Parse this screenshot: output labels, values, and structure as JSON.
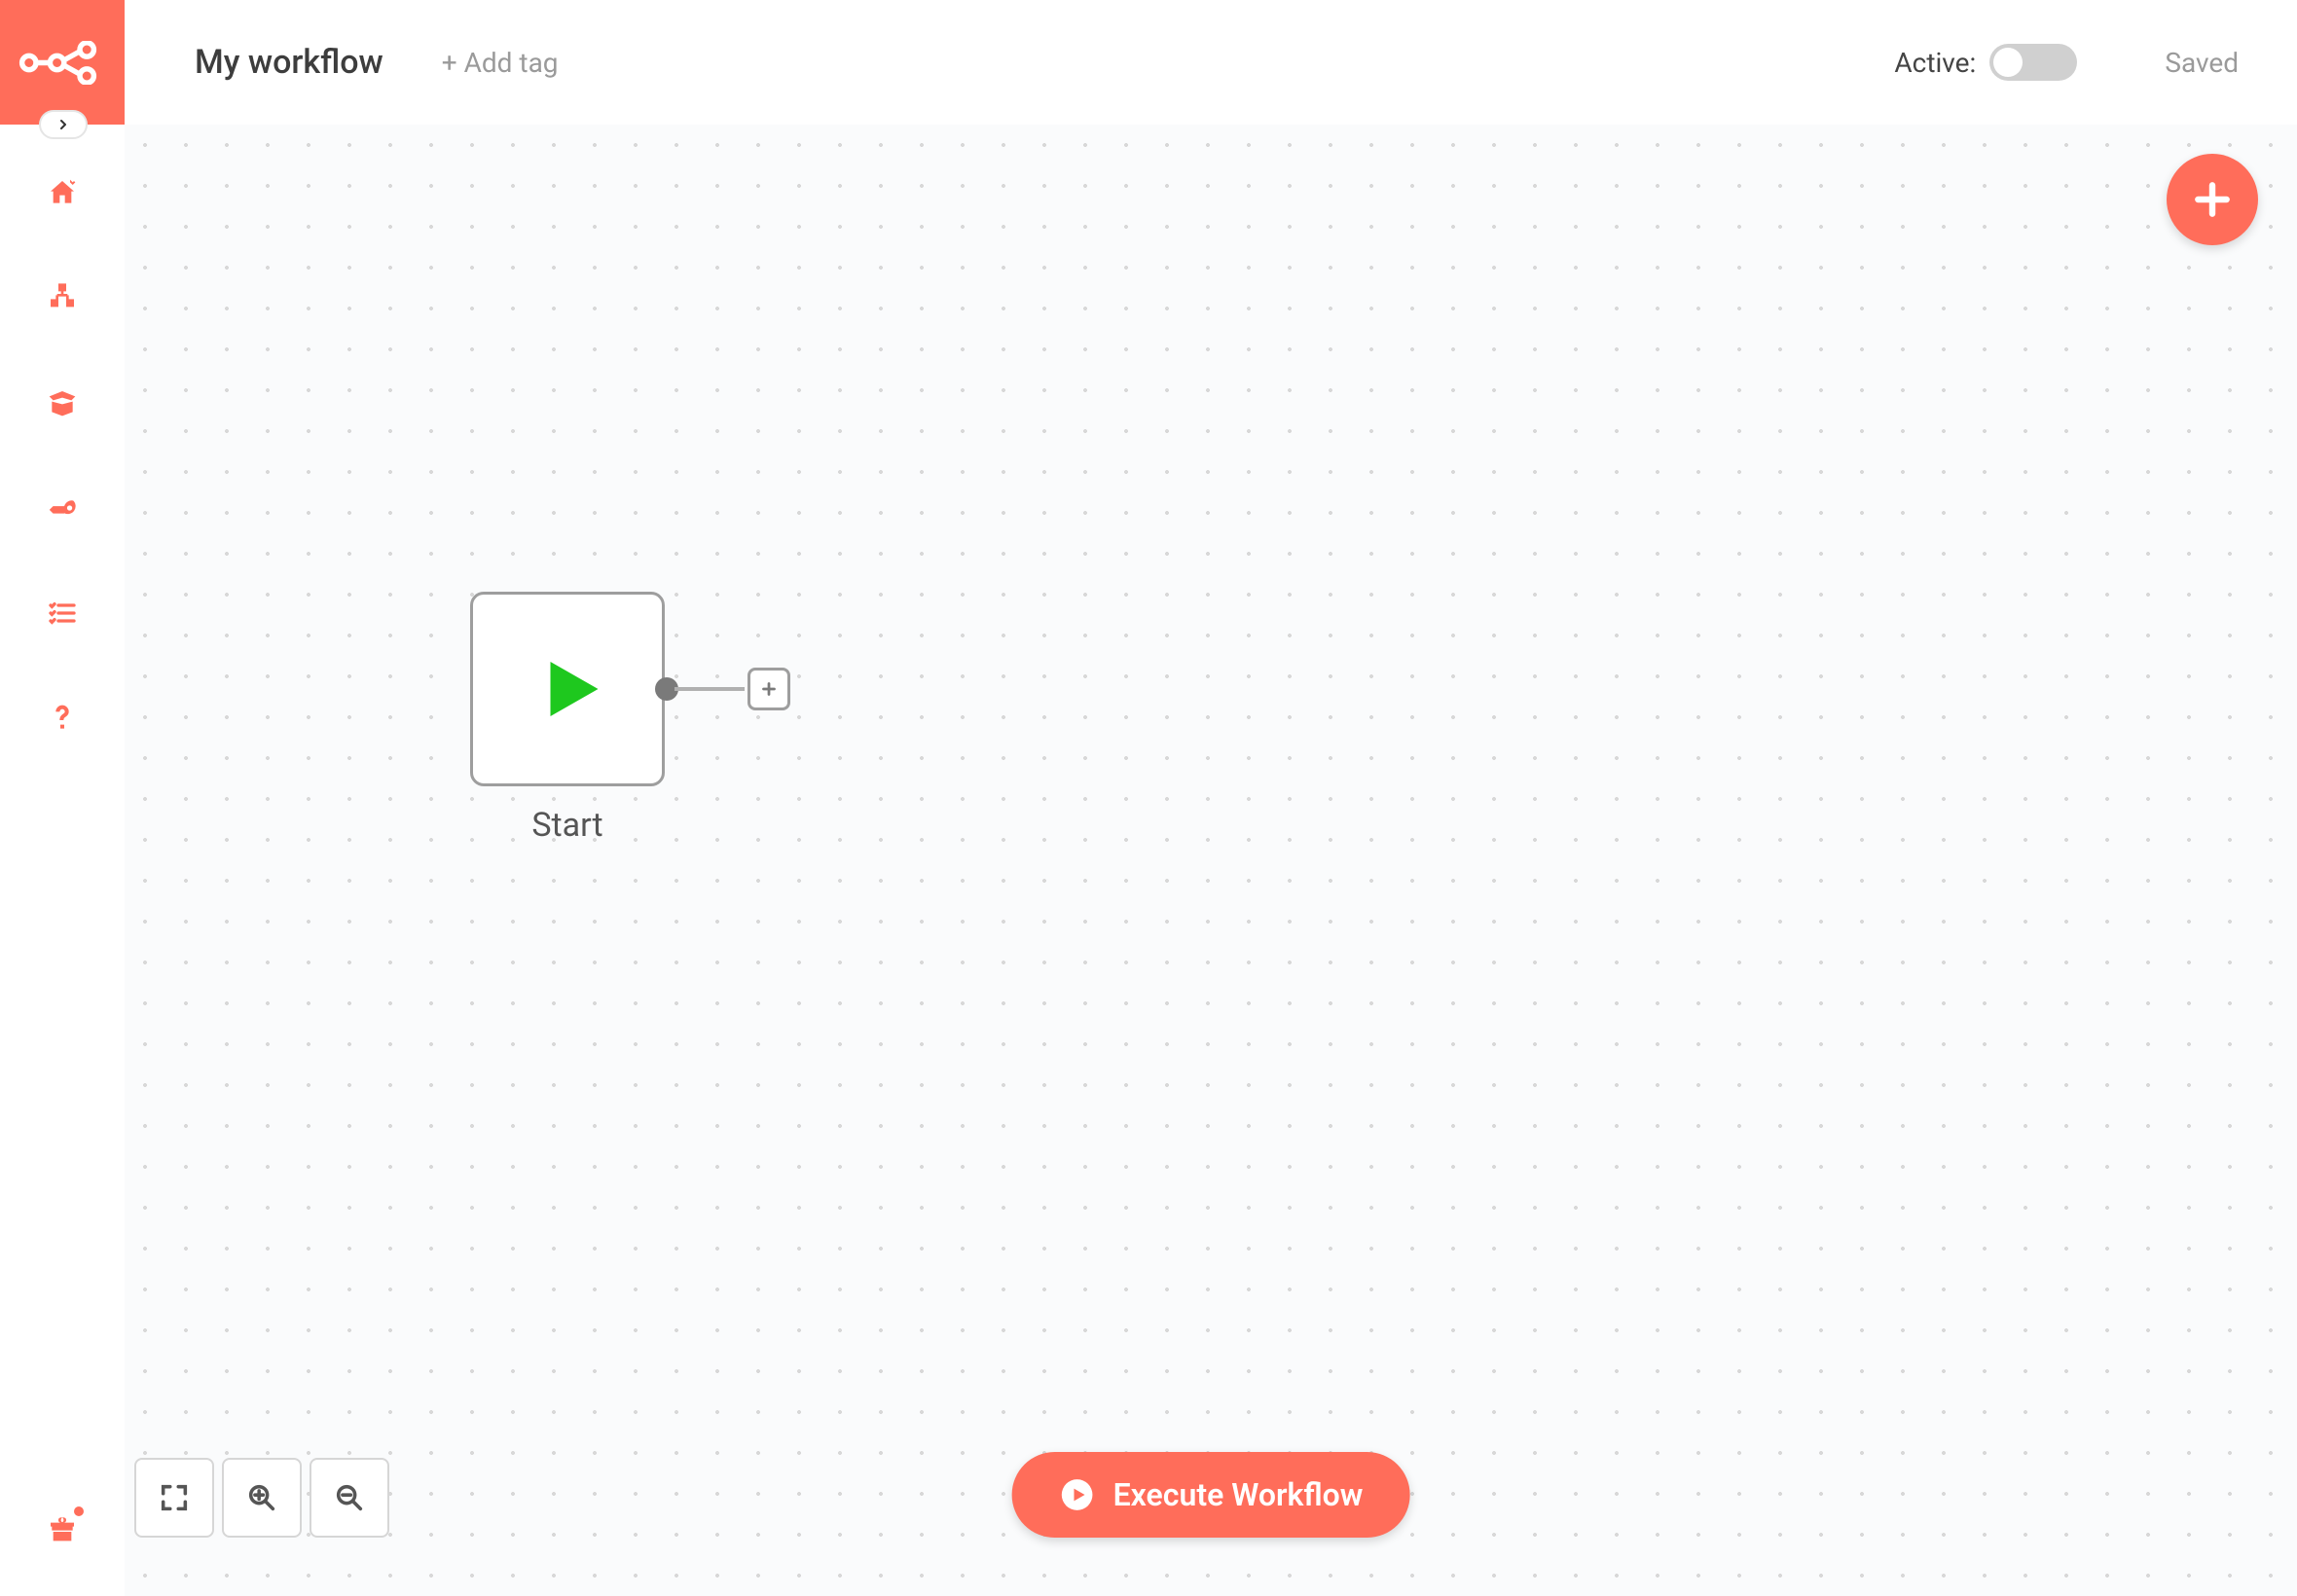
{
  "app": {
    "name": "n8n"
  },
  "topbar": {
    "workflow_name": "My workflow",
    "add_tag_label": "+ Add tag",
    "active_label": "Active:",
    "active": false,
    "status": "Saved"
  },
  "sidebar": {
    "items": [
      "home",
      "workflows",
      "templates",
      "credentials",
      "executions",
      "help"
    ],
    "bottom": "gift"
  },
  "canvas": {
    "start_node": {
      "label": "Start"
    }
  },
  "controls": {
    "zoom": [
      "fit",
      "in",
      "out"
    ],
    "execute_label": "Execute Workflow",
    "add_node_tooltip": "Add node"
  },
  "colors": {
    "brand": "#ff6d5a",
    "green": "#1ec81e"
  }
}
